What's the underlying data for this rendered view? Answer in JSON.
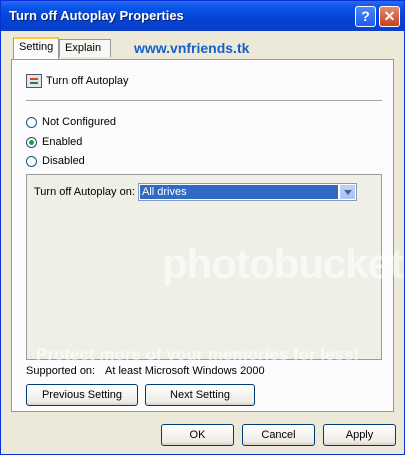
{
  "window": {
    "title": "Turn off Autoplay Properties"
  },
  "titlebar": {
    "help_glyph": "?",
    "close_glyph": "✕"
  },
  "tabs": [
    {
      "label": "Setting",
      "active": true
    },
    {
      "label": "Explain",
      "active": false
    }
  ],
  "watermark": {
    "site": "www.vnfriends.tk",
    "logo": "photobucket",
    "tagline": "Protect more of your memories for less!"
  },
  "policy": {
    "name": "Turn off Autoplay"
  },
  "options": [
    {
      "label": "Not Configured",
      "checked": false
    },
    {
      "label": "Enabled",
      "checked": true
    },
    {
      "label": "Disabled",
      "checked": false
    }
  ],
  "setting": {
    "label": "Turn off Autoplay on:",
    "selected": "All drives"
  },
  "supported": {
    "label": "Supported on:",
    "value": "At least Microsoft Windows 2000"
  },
  "buttons": {
    "previous": "Previous Setting",
    "next": "Next Setting",
    "ok": "OK",
    "cancel": "Cancel",
    "apply": "Apply"
  },
  "colors": {
    "titlebar": "#0a55e9",
    "accent": "#316ac5",
    "check": "#21a121"
  }
}
